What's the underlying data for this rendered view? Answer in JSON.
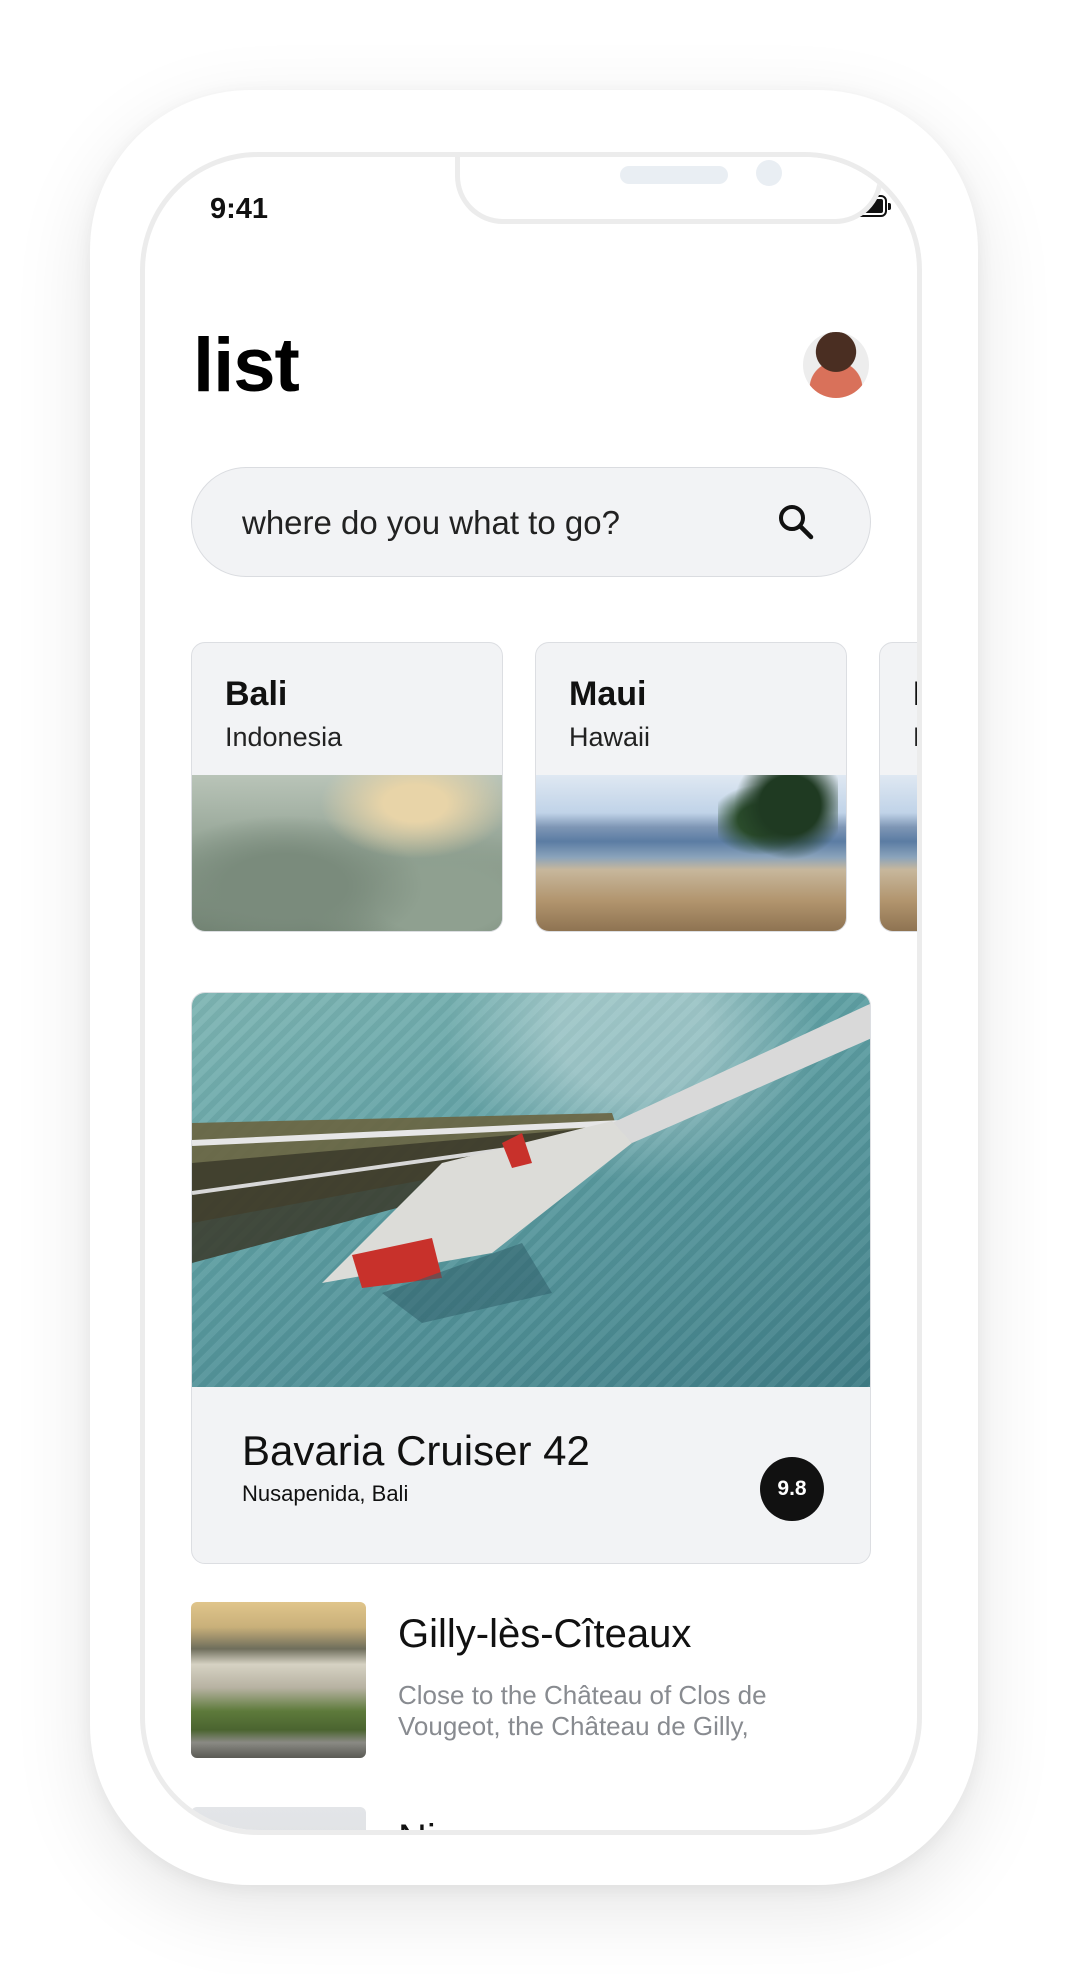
{
  "status_bar": {
    "time": "9:41"
  },
  "header": {
    "title": "list"
  },
  "search": {
    "placeholder": "where do you what to go?"
  },
  "destinations": [
    {
      "name": "Bali",
      "country": "Indonesia"
    },
    {
      "name": "Maui",
      "country": "Hawaii"
    },
    {
      "name": "M",
      "country": "H"
    }
  ],
  "featured": {
    "title": "Bavaria Cruiser 42",
    "subtitle": "Nusapenida, Bali",
    "rating": "9.8"
  },
  "list": [
    {
      "title": "Gilly-lès-Cîteaux",
      "description": "Close to the Château of Clos de Vougeot, the Château de Gilly,"
    },
    {
      "title": "Nice",
      "description": ""
    }
  ]
}
